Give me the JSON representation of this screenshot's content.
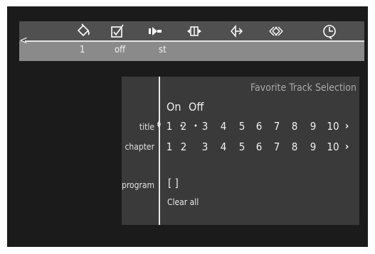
{
  "toolbar": {
    "icons": [
      {
        "name": "paint-bucket-icon",
        "value": "1"
      },
      {
        "name": "checkbox-icon",
        "value": "off"
      },
      {
        "name": "camera-angle-icon",
        "value": "st"
      },
      {
        "name": "frame-step-icon",
        "value": ""
      },
      {
        "name": "audio-icon",
        "value": ""
      },
      {
        "name": "search-icon",
        "value": ""
      },
      {
        "name": "timer-icon",
        "value": ""
      }
    ]
  },
  "panel": {
    "title": "Favorite Track Selection",
    "on_label": "On",
    "off_label": "Off",
    "title_label": "title",
    "chapter_label": "chapter",
    "program_label": "program",
    "program_value": "[ ]",
    "clear_all": "Clear all",
    "numbers": [
      "1",
      "2",
      "3",
      "4",
      "5",
      "6",
      "7",
      "8",
      "9",
      "10"
    ],
    "more_symbol": "›"
  },
  "colors": {
    "background": "#1b1b1b",
    "toolbar": "#505050",
    "toolbar_values_bar": "#8a8a8a",
    "panel": "#3a3a3a"
  }
}
